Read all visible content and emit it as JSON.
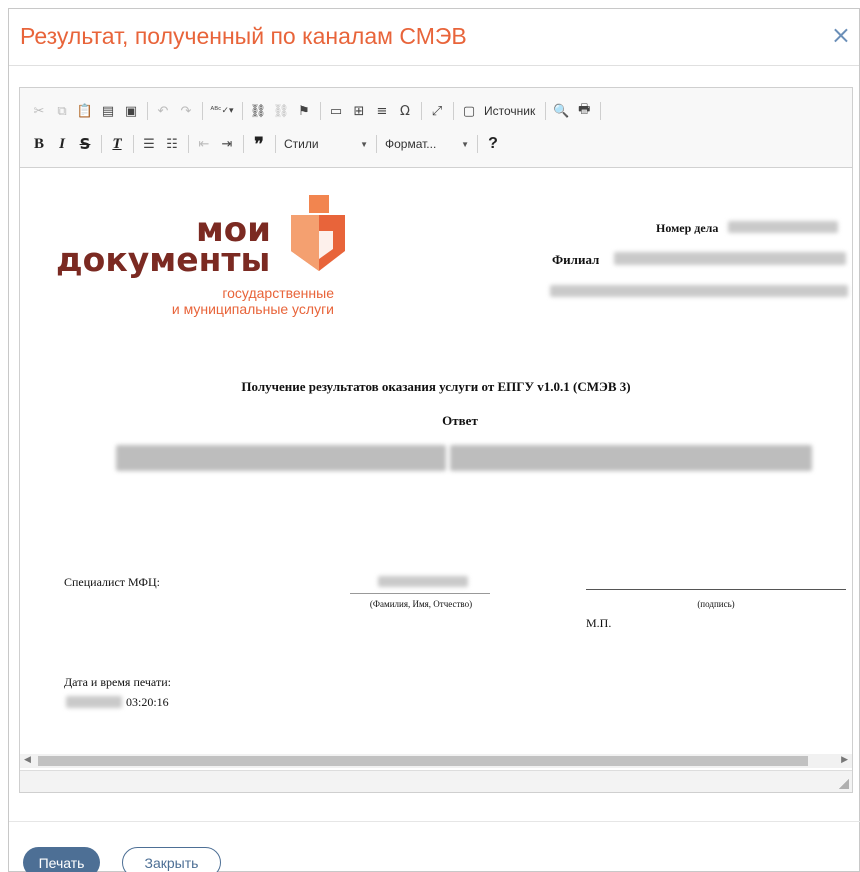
{
  "dialog": {
    "title": "Результат, полученный по каналам СМЭВ",
    "close_glyph": "×"
  },
  "toolbar": {
    "row1": {
      "source_label": "Источник"
    },
    "row2": {
      "styles_label": "Стили",
      "format_label": "Формат...",
      "help_glyph": "?"
    }
  },
  "document": {
    "logo": {
      "line1": "мои",
      "line2": "документы",
      "line3": "государственные",
      "line4": "и муниципальные услуги",
      "brand_color": "#7b2a22",
      "accent_color": "#e8643a"
    },
    "case_number_label": "Номер дела",
    "branch_label": "Филиал",
    "heading": "Получение результатов оказания услуги от ЕПГУ v1.0.1 (СМЭВ 3)",
    "subheading": "Ответ",
    "specialist_label": "Специалист МФЦ:",
    "fio_caption": "(Фамилия, Имя, Отчество)",
    "signature_caption": "(подпись)",
    "stamp_label": "М.П.",
    "print_datetime_label": "Дата и время печати:",
    "print_time": "03:20:16"
  },
  "buttons": {
    "print": "Печать",
    "close": "Закрыть"
  },
  "colors": {
    "title": "#e8643a",
    "primary_button": "#4d6f95"
  }
}
